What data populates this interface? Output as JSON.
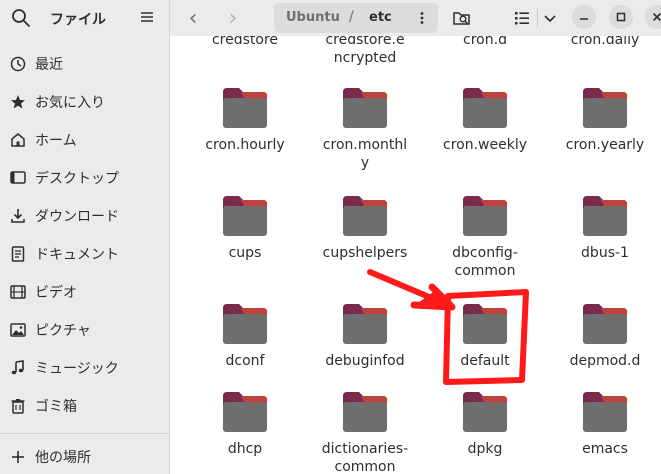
{
  "sidebar": {
    "title": "ファイル",
    "items": [
      {
        "label": "最近",
        "icon": "clock-icon"
      },
      {
        "label": "お気に入り",
        "icon": "star-icon"
      },
      {
        "label": "ホーム",
        "icon": "home-icon"
      },
      {
        "label": "デスクトップ",
        "icon": "desktop-icon"
      },
      {
        "label": "ダウンロード",
        "icon": "download-icon"
      },
      {
        "label": "ドキュメント",
        "icon": "document-icon"
      },
      {
        "label": "ビデオ",
        "icon": "video-icon"
      },
      {
        "label": "ピクチャ",
        "icon": "picture-icon"
      },
      {
        "label": "ミュージック",
        "icon": "music-icon"
      },
      {
        "label": "ゴミ箱",
        "icon": "trash-icon"
      }
    ],
    "other_locations": "他の場所"
  },
  "header": {
    "back": "‹",
    "forward": "›",
    "path": [
      "Ubuntu",
      "etc"
    ],
    "path_separator": "/"
  },
  "top_cut_names": [
    "credstore",
    "credstore.e\nncrypted",
    "cron.d",
    "cron.daily"
  ],
  "top_cut_name_line1": [
    "credstore",
    "credstore.e",
    "cron.d",
    "cron.daily"
  ],
  "top_cut_name_line2": [
    "",
    "ncrypted",
    "",
    ""
  ],
  "files": [
    {
      "name": "cron.hourly"
    },
    {
      "name": "cron.monthly"
    },
    {
      "name": "cron.weekly"
    },
    {
      "name": "cron.yearly"
    },
    {
      "name": "cups"
    },
    {
      "name": "cupshelpers"
    },
    {
      "name": "dbconfig-common"
    },
    {
      "name": "dbus-1"
    },
    {
      "name": "dconf"
    },
    {
      "name": "debuginfod"
    },
    {
      "name": "default"
    },
    {
      "name": "depmod.d"
    },
    {
      "name": "dhcp"
    },
    {
      "name": "dictionaries-common"
    },
    {
      "name": "dpkg"
    },
    {
      "name": "emacs"
    }
  ],
  "file_names_display": [
    "cron.hourly",
    "cron.monthl\ny",
    "cron.weekly",
    "cron.yearly",
    "cups",
    "cupshelpers",
    "dbconfig-\ncommon",
    "dbus-1",
    "dconf",
    "debuginfod",
    "default",
    "depmod.d",
    "dhcp",
    "dictionaries-\ncommon",
    "dpkg",
    "emacs"
  ],
  "colors": {
    "folder_body": "#6e6e6e",
    "folder_tab_top": "#c7453c",
    "folder_tab_left": "#7a2a4a",
    "annotation": "#ff0000"
  }
}
